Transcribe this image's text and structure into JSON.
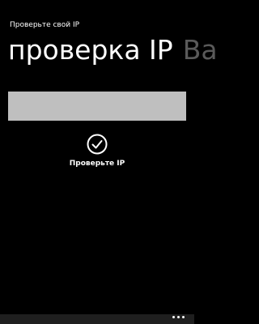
{
  "app": {
    "title": "Проверьте свой IP"
  },
  "pivot": {
    "active_label": "проверка IP",
    "next_label": "Ва"
  },
  "ip_field": {
    "value": ""
  },
  "check_button": {
    "label": "Проверьте IP",
    "icon": "check-circle-icon"
  },
  "app_bar": {
    "more_icon": "ellipsis-icon"
  },
  "colors": {
    "background": "#000000",
    "text": "#ffffff",
    "inactive_header": "#5a5a5a",
    "field": "#bfbfbf",
    "app_bar": "#1f1f1f"
  }
}
